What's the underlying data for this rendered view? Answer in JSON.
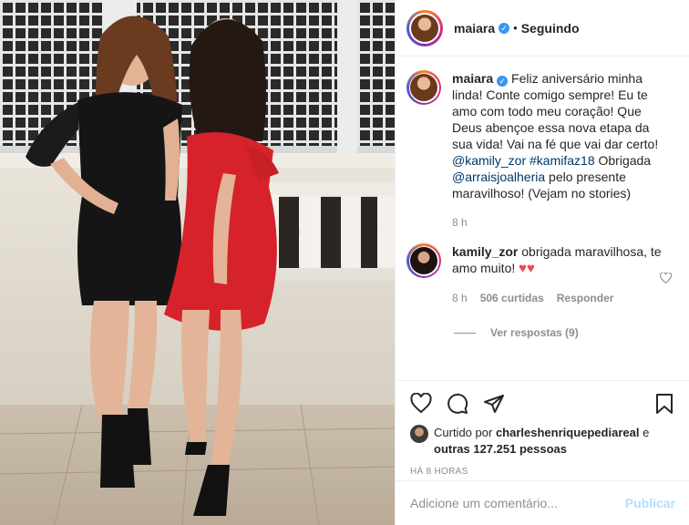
{
  "post": {
    "author": "maiara",
    "follow_status": "Seguindo",
    "separator": "•",
    "verified_mark": "✓",
    "caption": {
      "author": "maiara",
      "text_1": "Feliz aniversário minha linda! Conte comigo sempre! Eu te amo com todo meu coração! Que Deus abençoe essa nova etapa da sua vida! Vai na fé que vai dar certo! ",
      "mention_1": "@kamily_zor",
      "space": " ",
      "hashtag": "#kamifaz18",
      "text_2": " Obrigada ",
      "mention_2": "@arraisjoalheria",
      "text_3": " pelo presente maravilhoso! (Vejam no stories)",
      "age": "8 h"
    },
    "comment": {
      "author": "kamily_zor",
      "text": "obrigada maravilhosa, te amo muito!",
      "emoji": "♥♥",
      "age": "8 h",
      "likes": "506 curtidas",
      "reply": "Responder",
      "view_replies": "Ver respostas (9)"
    },
    "likes": {
      "prefix": "Curtido por",
      "user": "charleshenriquepediareal",
      "connector": "e",
      "others": "outras 127.251 pessoas"
    },
    "timestamp": "HÁ 8 HORAS",
    "add_comment": {
      "placeholder": "Adicione um comentário...",
      "publish": "Publicar"
    }
  },
  "icons": {
    "like": "heart-icon",
    "comment": "comment-icon",
    "share": "paper-plane-icon",
    "save": "bookmark-icon"
  },
  "colors": {
    "verified": "#3897f0",
    "link": "#00376b",
    "muted": "#8e8e8e",
    "publish_disabled": "#b2dffc",
    "heart_emoji": "#ed4956"
  }
}
